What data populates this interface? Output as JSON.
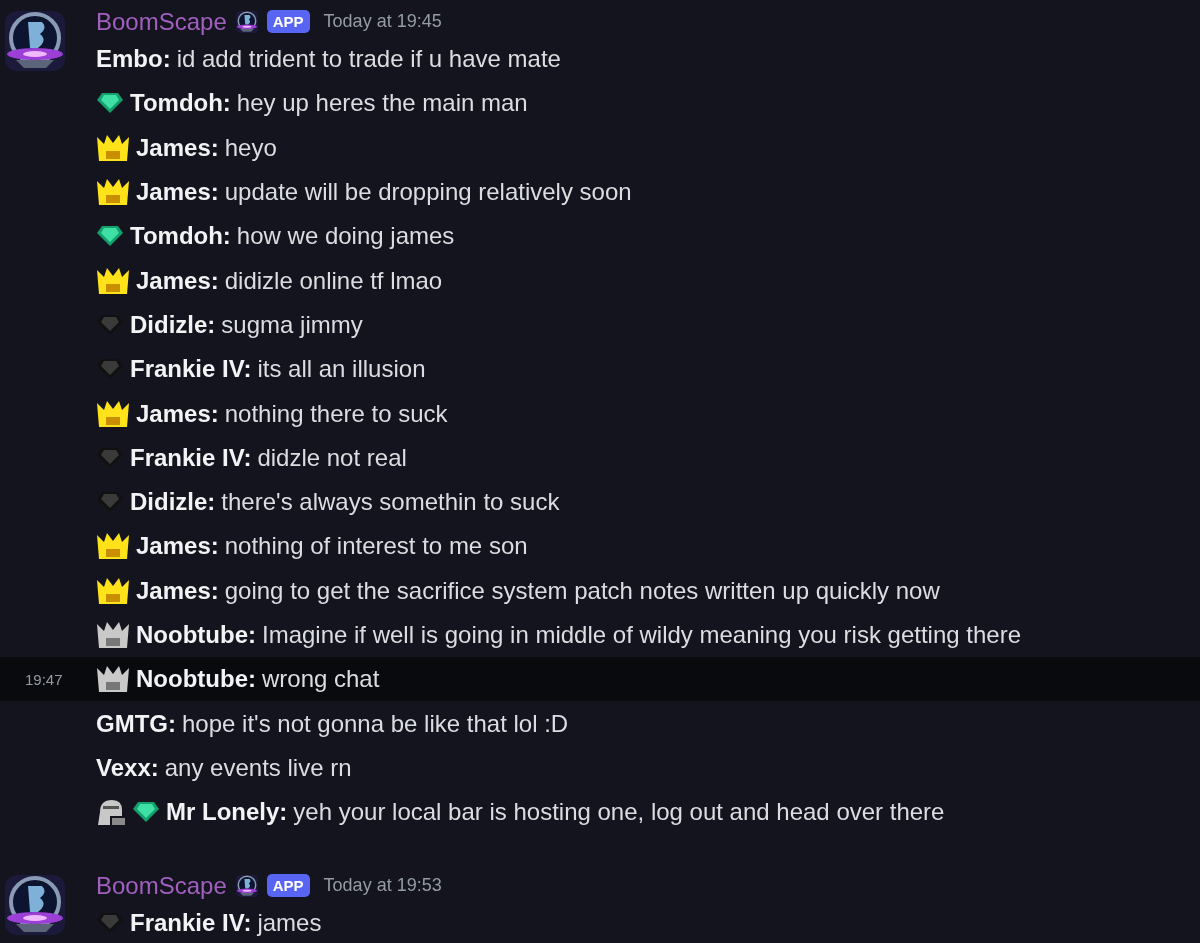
{
  "groups": [
    {
      "author": "BoomScape",
      "badge": "APP",
      "time": "Today at 19:45",
      "lines": [
        {
          "name": "Embo:",
          "text": "id add trident to trade if u have mate",
          "highlighted": false
        },
        {
          "icons": [
            {
              "kind": "gem-green"
            }
          ],
          "name": "Tomdoh:",
          "text": "hey up heres the main man",
          "highlighted": false
        },
        {
          "icons": [
            {
              "kind": "crown-gold"
            }
          ],
          "name": "James:",
          "text": "heyo",
          "highlighted": false
        },
        {
          "icons": [
            {
              "kind": "crown-gold"
            }
          ],
          "name": "James:",
          "text": "update will be dropping relatively soon",
          "highlighted": false
        },
        {
          "icons": [
            {
              "kind": "gem-green"
            }
          ],
          "name": "Tomdoh:",
          "text": "how we doing james",
          "highlighted": false
        },
        {
          "icons": [
            {
              "kind": "crown-gold"
            }
          ],
          "name": "James:",
          "text": "didizle online tf lmao",
          "highlighted": false
        },
        {
          "icons": [
            {
              "kind": "gem-dark"
            }
          ],
          "name": "Didizle:",
          "text": "sugma jimmy",
          "highlighted": false
        },
        {
          "icons": [
            {
              "kind": "gem-dark"
            }
          ],
          "name": "Frankie IV:",
          "text": "its all an illusion",
          "highlighted": false
        },
        {
          "icons": [
            {
              "kind": "crown-gold"
            }
          ],
          "name": "James:",
          "text": "nothing there to suck",
          "highlighted": false
        },
        {
          "icons": [
            {
              "kind": "gem-dark"
            }
          ],
          "name": "Frankie IV:",
          "text": "didzle not real",
          "highlighted": false
        },
        {
          "icons": [
            {
              "kind": "gem-dark"
            }
          ],
          "name": "Didizle:",
          "text": "there's always somethin to suck",
          "highlighted": false
        },
        {
          "icons": [
            {
              "kind": "crown-gold"
            }
          ],
          "name": "James:",
          "text": "nothing of interest to me son",
          "highlighted": false
        },
        {
          "icons": [
            {
              "kind": "crown-gold"
            }
          ],
          "name": "James:",
          "text": "going to get the sacrifice system patch notes written up quickly now",
          "highlighted": false
        },
        {
          "icons": [
            {
              "kind": "crown-grey"
            }
          ],
          "name": "Noobtube:",
          "text": "Imagine if well is going in middle of wildy meaning you risk getting there",
          "highlighted": false
        },
        {
          "icons": [
            {
              "kind": "crown-grey"
            }
          ],
          "name": "Noobtube:",
          "text": "wrong chat",
          "highlighted": true,
          "time": "19:47"
        },
        {
          "name": "GMTG:",
          "text": "hope it's not gonna be like that lol :D",
          "highlighted": false
        },
        {
          "name": "Vexx:",
          "text": "any events live rn",
          "highlighted": false
        },
        {
          "icons": [
            {
              "kind": "helmet"
            },
            {
              "kind": "gem-green"
            }
          ],
          "name": "Mr Lonely:",
          "text": "yeh your local bar is hosting one, log out and head over there",
          "highlighted": false
        }
      ]
    },
    {
      "author": "BoomScape",
      "badge": "APP",
      "time": "Today at 19:53",
      "lines": [
        {
          "icons": [
            {
              "kind": "gem-dark"
            }
          ],
          "name": "Frankie IV:",
          "text": "james",
          "highlighted": false
        }
      ]
    }
  ]
}
